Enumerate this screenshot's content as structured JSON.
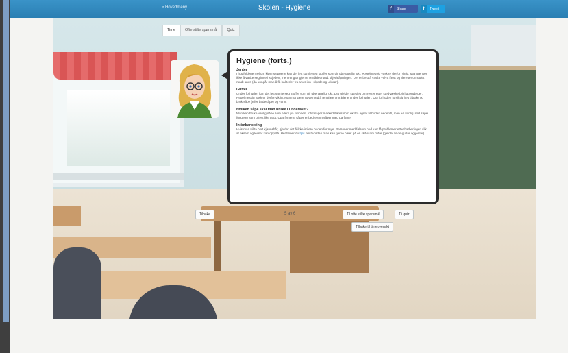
{
  "header": {
    "menu_link": "« Hovedmeny",
    "title": "Skolen - Hygiene",
    "share_facebook": "Share",
    "share_twitter": "Tweet",
    "facebook_color": "#3b5ba4",
    "twitter_color": "#1da1e2"
  },
  "tabs": [
    {
      "label": "Time",
      "active": true
    },
    {
      "label": "Ofte stilte spørsmål",
      "active": false
    },
    {
      "label": "Quiz",
      "active": false
    }
  ],
  "card": {
    "title": "Hygiene (forts.)",
    "sections": [
      {
        "heading": "Jenter",
        "text": "I hudfoldene mellom kjønnsleppene kan det lett samle seg stoffer som gir ubehagelig lukt. Regelmessig vask er derfor viktig. Man trenger ikke å vaske seg inne i skjeden, men rengjør gjerne området rundt skjedeåpningen. Det er best å vaske vulva først og deretter området rundt anus (da unngår man å få bakterier fra anus inn i skjede og urinrør)."
      },
      {
        "heading": "Gutter",
        "text": "Under forhuden kan det lett samle seg stoffer som gir ubehagelig lukt. Det gjelder spesielt om rester etter sædvæske blir liggende der. Regelmessig vask er derfor viktig. Man må være nøye med å rengjøre områdene under forhuden. Dra forhuden forsiktig helt tilbake og bruk såpe (eller badesåpe) og vann."
      },
      {
        "heading": "Hvilken såpe skal man bruke i underlivet?",
        "text": "Man kan bruke vanlig såpe som ellers på kroppen. Intimsåper markedsføres som ekstra egnet til huden nedentil, men en vanlig mild såpe fungerer som oftest like godt. Uparfymerte såper er bedre enn såper med parfyme."
      },
      {
        "heading": "Intimbarbering",
        "text_before_link": "Hvis man vil ta bort kjønnshår, gjelder det å ikke irritere huden for mye. Personer med følsom hud kan få problemer etter barberingen slik at eksem og kviser kan oppstå. Her finner du ",
        "link": "tips",
        "text_after_link": " om hvordan man kan fjerne håret på en skånsom måte (gjelder både gutter og jenter)."
      }
    ]
  },
  "nav": {
    "back": "Tilbake",
    "pager": "5 av 6",
    "faq": "Til ofte stilte spørsmål",
    "quiz": "Til quiz",
    "overview": "Tilbake til timeoversikt"
  }
}
